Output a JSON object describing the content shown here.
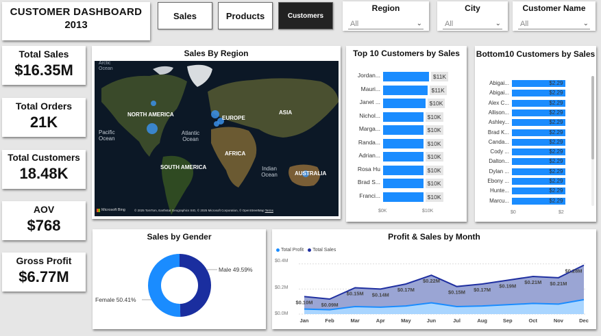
{
  "header": {
    "title": "CUSTOMER DASHBOARD",
    "year": "2013"
  },
  "nav": {
    "sales": "Sales",
    "products": "Products",
    "customers": "Customers"
  },
  "slicers": [
    {
      "label": "Region",
      "value": "All"
    },
    {
      "label": "City",
      "value": "All"
    },
    {
      "label": "Customer Name",
      "value": "All"
    }
  ],
  "kpis": [
    {
      "label": "Total Sales",
      "value": "$16.35M"
    },
    {
      "label": "Total Orders",
      "value": "21K"
    },
    {
      "label": "Total Customers",
      "value": "18.48K"
    },
    {
      "label": "AOV",
      "value": "$768"
    },
    {
      "label": "Gross Profit",
      "value": "$6.77M"
    }
  ],
  "map": {
    "title": "Sales By Region",
    "labels": {
      "arctic": "Arctic Ocean",
      "north_america": "NORTH AMERICA",
      "europe": "EUROPE",
      "asia": "ASIA",
      "pacific": "Pacific Ocean",
      "atlantic": "Atlantic Ocean",
      "africa": "AFRICA",
      "south_america": "SOUTH AMERICA",
      "indian": "Indian Ocean",
      "australia": "AUSTRALIA"
    },
    "brand": "Microsoft Bing",
    "attribution": "© 2025 TomTom, Earthstar Geographics SIO, © 2025 Microsoft Corporation, © OpenStreetMap",
    "terms": "Terms"
  },
  "top10": {
    "title": "Top 10 Customers by Sales",
    "axis_ticks": [
      "$0K",
      "$10K"
    ]
  },
  "bottom10": {
    "title": "Bottom10 Customers by Sales",
    "axis_ticks": [
      "$0",
      "$2"
    ]
  },
  "gender": {
    "title": "Sales by Gender",
    "male_label": "Male 49.59%",
    "female_label": "Female 50.41%"
  },
  "monthly": {
    "title": "Profit & Sales by Month",
    "legend_profit": "Total Profit",
    "legend_sales": "Total Sales",
    "y_ticks": [
      "$0.4M",
      "$0.2M",
      "$0.0M"
    ]
  },
  "colors": {
    "bar": "#1a8cff",
    "dark": "#1f2fa0",
    "label_bg": "#e6e6e6"
  },
  "chart_data": [
    {
      "type": "bar",
      "title": "Top 10 Customers by Sales",
      "orientation": "horizontal",
      "categories": [
        "Jordan...",
        "Mauri...",
        "Janet ...",
        "Nichol...",
        "Marga...",
        "Randa...",
        "Adrian...",
        "Rosa Hu",
        "Brad S...",
        "Franci..."
      ],
      "values": [
        11.4,
        11.0,
        10.5,
        10.0,
        10.0,
        10.0,
        10.0,
        10.0,
        10.0,
        10.0
      ],
      "data_labels": [
        "$11K",
        "$11K",
        "$10K",
        "$10K",
        "$10K",
        "$10K",
        "$10K",
        "$10K",
        "$10K",
        "$10K"
      ],
      "xlim": [
        0,
        15
      ],
      "unit": "K"
    },
    {
      "type": "bar",
      "title": "Bottom10 Customers by Sales",
      "orientation": "horizontal",
      "categories": [
        "Abigai...",
        "Abigai...",
        "Alex C...",
        "Allison...",
        "Ashley...",
        "Brad K...",
        "Canda...",
        "Cody ...",
        "Dalton...",
        "Dylan ...",
        "Ebony ...",
        "Hunte...",
        "Marcu..."
      ],
      "values": [
        2.29,
        2.29,
        2.29,
        2.29,
        2.29,
        2.29,
        2.29,
        2.29,
        2.29,
        2.29,
        2.29,
        2.29,
        2.29
      ],
      "data_labels": [
        "$2.29",
        "$2.29",
        "$2.29",
        "$2.29",
        "$2.29",
        "$2.29",
        "$2.29",
        "$2.29",
        "$2.29",
        "$2.29",
        "$2.29",
        "$2.29",
        "$2.29"
      ],
      "xlim": [
        0,
        2.6
      ]
    },
    {
      "type": "pie",
      "title": "Sales by Gender",
      "donut": true,
      "slices": [
        {
          "name": "Male",
          "value": 49.59,
          "color": "#1a2e9f"
        },
        {
          "name": "Female",
          "value": 50.41,
          "color": "#1a8cff"
        }
      ]
    },
    {
      "type": "area",
      "title": "Profit & Sales by Month",
      "x": [
        "Jan",
        "Feb",
        "Mar",
        "Apr",
        "May",
        "Jun",
        "Jul",
        "Aug",
        "Sep",
        "Oct",
        "Nov",
        "Dec"
      ],
      "series": [
        {
          "name": "Total Sales",
          "values": [
            0.14,
            0.12,
            0.21,
            0.2,
            0.24,
            0.31,
            0.22,
            0.24,
            0.27,
            0.3,
            0.29,
            0.39
          ],
          "labels": [
            "$0.10M",
            "$0.09M",
            "$0.15M",
            "$0.14M",
            "$0.17M",
            "$0.22M",
            "$0.15M",
            "$0.17M",
            "$0.19M",
            "$0.21M",
            "$0.21M",
            "$0.28M"
          ]
        },
        {
          "name": "Total Profit",
          "values": [
            0.04,
            0.035,
            0.06,
            0.055,
            0.065,
            0.09,
            0.06,
            0.065,
            0.075,
            0.085,
            0.08,
            0.115
          ]
        }
      ],
      "ylim": [
        0,
        0.42
      ]
    }
  ]
}
